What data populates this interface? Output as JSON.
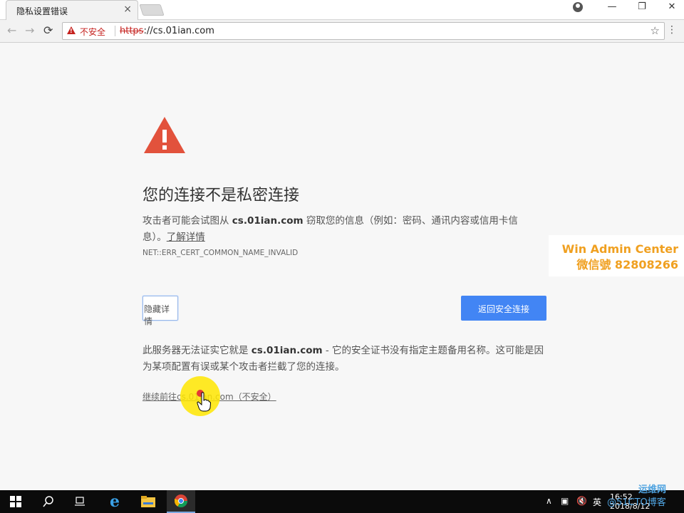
{
  "browser": {
    "tab_title": "隐私设置错误",
    "tab_close": "×",
    "security_label": "不安全",
    "url_scheme": "https",
    "url_rest": "://cs.01ian.com",
    "window_controls": [
      "—",
      "❐",
      "✕"
    ]
  },
  "interstitial": {
    "heading": "您的连接不是私密连接",
    "desc_prefix": "攻击者可能会试图从",
    "desc_domain": "cs.01ian.com",
    "desc_suffix": "窃取您的信息（例如：密码、通讯内容或信用卡信息）。",
    "learn_more": "了解详情",
    "error_code": "NET::ERR_CERT_COMMON_NAME_INVALID",
    "hide_details_button": "隐藏详情",
    "back_button": "返回安全连接",
    "details_prefix": "此服务器无法证实它就是",
    "details_domain": "cs.01ian.com",
    "details_suffix": "- 它的安全证书没有指定主题备用名称。这可能是因为某项配置有误或某个攻击者拦截了您的连接。",
    "proceed_link": "继续前往cs.01ian.com（不安全）"
  },
  "watermark": {
    "line1": "Win Admin Center",
    "line2": "微信號 82808266"
  },
  "taskbar": {
    "ime": "英",
    "time": "16:52",
    "date": "2018/8/12",
    "corner_wm1": "运维网",
    "corner_wm2": "@51CTO博客"
  },
  "colors": {
    "accent": "#4285f4",
    "danger": "#c5221f",
    "alert_icon": "#e2523c",
    "watermark": "#f0a020"
  }
}
